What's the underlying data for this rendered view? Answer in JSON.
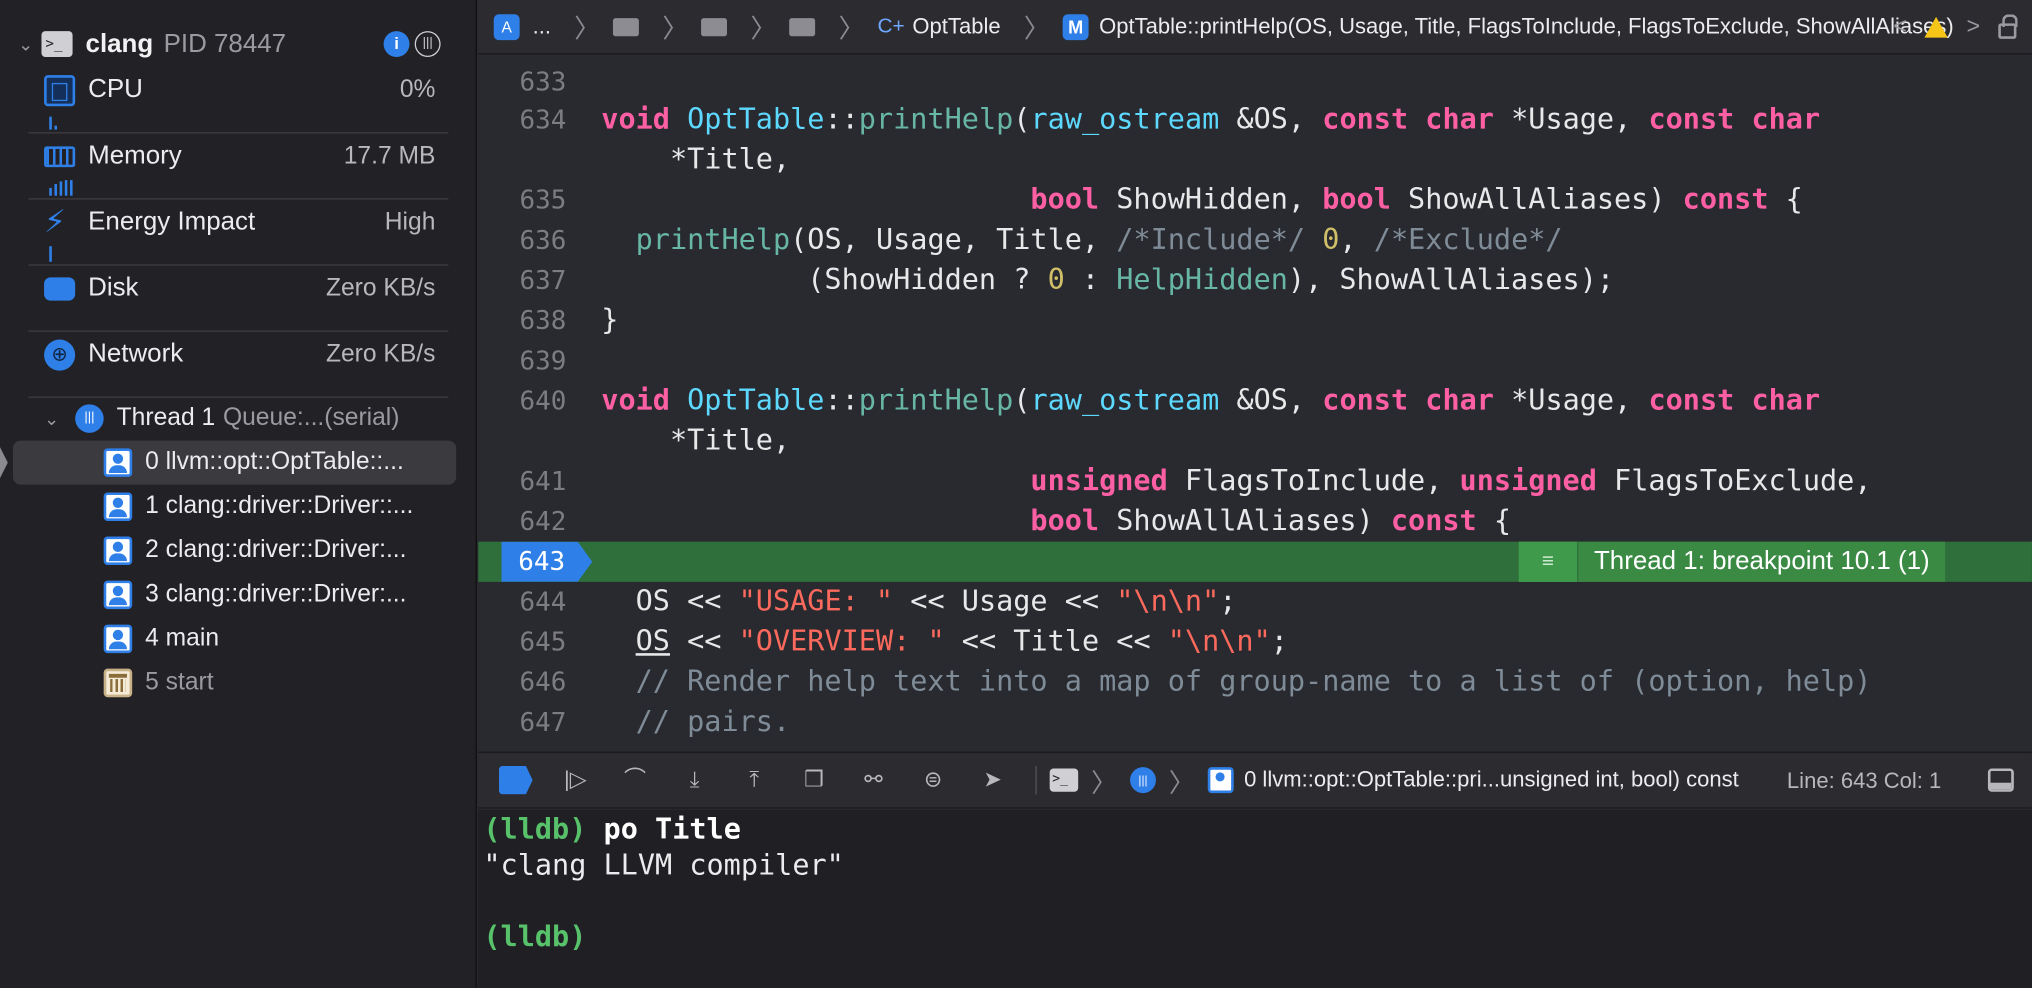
{
  "process": {
    "name": "clang",
    "pid": "PID 78447"
  },
  "gauges": [
    {
      "label": "CPU",
      "value": "0%"
    },
    {
      "label": "Memory",
      "value": "17.7 MB"
    },
    {
      "label": "Energy Impact",
      "value": "High"
    },
    {
      "label": "Disk",
      "value": "Zero KB/s"
    },
    {
      "label": "Network",
      "value": "Zero KB/s"
    }
  ],
  "thread": {
    "name": "Thread 1",
    "queue": "Queue:...(serial)"
  },
  "frames": [
    "0 llvm::opt::OptTable::...",
    "1 clang::driver::Driver::...",
    "2 clang::driver::Driver:...",
    "3 clang::driver::Driver:...",
    "4 main",
    "5 start"
  ],
  "jumpbar": {
    "ellipsis": "...",
    "class_name": "OptTable",
    "class_glyph": "C+",
    "method_glyph": "M",
    "method": "OptTable::printHelp(OS, Usage, Title, FlagsToInclude, FlagsToExclude, ShowAllAliases)"
  },
  "editor": {
    "line_numbers": [
      "633",
      "634",
      "",
      "635",
      "636",
      "637",
      "638",
      "639",
      "640",
      "",
      "641",
      "642",
      "643",
      "644",
      "645",
      "646",
      "647"
    ],
    "breakpoint_line": "643",
    "breakpoint_annotation": "Thread 1: breakpoint 10.1 (1)"
  },
  "debugbar": {
    "frame": "0 llvm::opt::OptTable::pri...unsigned int, bool) const",
    "line_col": "Line: 643  Col: 1"
  },
  "console": {
    "prompt": "(lldb)",
    "command": "po Title",
    "output": "\"clang LLVM compiler\""
  },
  "colors": {
    "accent": "#2f7fe8",
    "breakpoint_line": "#2f6f3b",
    "keyword": "#fc5fa3",
    "string": "#fc6a5d",
    "lldb_prompt": "#58c26b"
  }
}
